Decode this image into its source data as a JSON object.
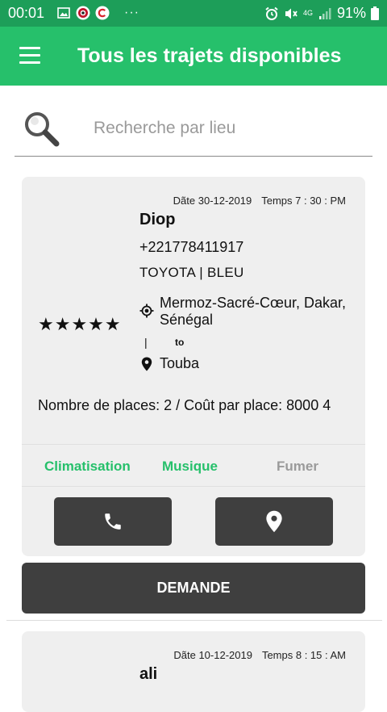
{
  "status_bar": {
    "time": "00:01",
    "more": "···",
    "network": "4G",
    "battery": "91%",
    "left_icons": [
      "image-icon",
      "target-icon",
      "c-icon"
    ],
    "right_icons": [
      "alarm-icon",
      "mute-icon",
      "signal-icon",
      "battery-icon"
    ]
  },
  "header": {
    "title": "Tous les trajets disponibles",
    "menu_icon": "menu-icon"
  },
  "search": {
    "placeholder": "Recherche par lieu",
    "value": "",
    "icon": "search-icon"
  },
  "trips": [
    {
      "date": "Dãte 30-12-2019",
      "time": "Temps 7 : 30 : PM",
      "driver": "Diop",
      "phone": "+221778411917",
      "car": "TOYOTA  |  BLEU",
      "rating": "★★★★★",
      "rating_value": 5,
      "from": "Mermoz-Sacré-Cœur, Dakar, Sénégal",
      "route_line": "|",
      "to_label": "to",
      "to": "Touba",
      "places": "Nombre de places: 2 /  Coût par place: 8000 4",
      "features": [
        {
          "label": "Climatisation",
          "enabled": true
        },
        {
          "label": "Musique",
          "enabled": true
        },
        {
          "label": "Fumer",
          "enabled": false
        }
      ],
      "call_icon": "phone-icon",
      "location_icon": "location-pin-icon",
      "request_label": "DEMANDE"
    },
    {
      "date": "Dãte 10-12-2019",
      "time": "Temps 8 : 15 : AM",
      "driver": "ali"
    }
  ],
  "colors": {
    "status_bar": "#1d9e59",
    "header": "#26c06b",
    "feature_on": "#26c06b",
    "feature_off": "#9a9a9a",
    "button": "#3f3f3f",
    "card": "#efefef"
  }
}
